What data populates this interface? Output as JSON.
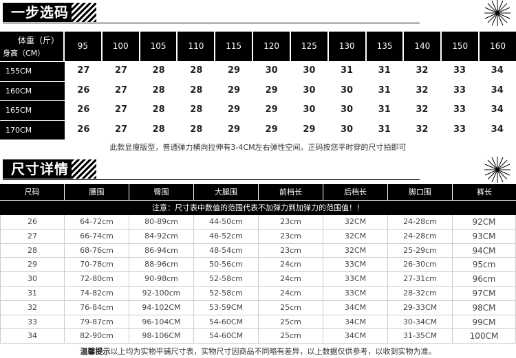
{
  "section1": {
    "title": "一步选码"
  },
  "table1": {
    "corner_top": "体重（斤）",
    "corner_bottom": "身高（CM）",
    "weights": [
      "95",
      "100",
      "105",
      "110",
      "115",
      "120",
      "125",
      "130",
      "135",
      "140",
      "150",
      "160"
    ],
    "rows": [
      {
        "height": "155CM",
        "sizes": [
          "27",
          "27",
          "28",
          "28",
          "29",
          "30",
          "30",
          "31",
          "31",
          "32",
          "33",
          "34"
        ]
      },
      {
        "height": "160CM",
        "sizes": [
          "26",
          "27",
          "28",
          "28",
          "29",
          "29",
          "30",
          "30",
          "31",
          "32",
          "33",
          "34"
        ]
      },
      {
        "height": "165CM",
        "sizes": [
          "26",
          "27",
          "28",
          "28",
          "29",
          "29",
          "30",
          "30",
          "31",
          "32",
          "33",
          "34"
        ]
      },
      {
        "height": "170CM",
        "sizes": [
          "26",
          "27",
          "28",
          "28",
          "29",
          "29",
          "29",
          "30",
          "31",
          "32",
          "33",
          "34"
        ]
      }
    ],
    "note": "此款显瘦版型，普通弹力横向拉伸有3-4CM左右弹性空间。正码按您平时穿的尺寸拍即可"
  },
  "section2": {
    "title": "尺寸详情"
  },
  "table2": {
    "headers": [
      "尺码",
      "腰围",
      "臀围",
      "大腿围",
      "前档长",
      "后档长",
      "脚口围",
      "裤长"
    ],
    "notice": "注意：尺寸表中数值的范围代表不加弹力到加弹力的范围值！！",
    "rows": [
      [
        "26",
        "64-72cm",
        "80-89cm",
        "44-50cm",
        "23cm",
        "32CM",
        "24-28cm",
        "92CM"
      ],
      [
        "27",
        "66-74cm",
        "84-92cm",
        "46-52cm",
        "23cm",
        "32CM",
        "24-28cm",
        "93CM"
      ],
      [
        "28",
        "68-76cm",
        "86-94cm",
        "48-54cm",
        "23cm",
        "32CM",
        "25-29cm",
        "94CM"
      ],
      [
        "29",
        "70-78cm",
        "88-96cm",
        "50-56cm",
        "24cm",
        "33CM",
        "26-30cm",
        "95cm"
      ],
      [
        "30",
        "72-80cm",
        "90-98cm",
        "52-58cm",
        "24cm",
        "33CM",
        "27-31cm",
        "96cm"
      ],
      [
        "31",
        "74-82cm",
        "92-100cm",
        "52-58cm",
        "24cm",
        "33CM",
        "28-32cm",
        "97CM"
      ],
      [
        "32",
        "76-84cm",
        "94-102CM",
        "53-59CM",
        "25cm",
        "34CM",
        "29-33CM",
        "98CM"
      ],
      [
        "33",
        "79-87cm",
        "96-104CM",
        "54-60CM",
        "25cm",
        "34CM",
        "30-34CM",
        "99CM"
      ],
      [
        "34",
        "82-90cm",
        "98-106CM",
        "54-60CM",
        "25cm",
        "34CM",
        "31-35CM",
        "100CM"
      ]
    ]
  },
  "footer": {
    "bold": "温馨提示",
    "text": "以上均为实物平铺尺寸表，实物尺寸因商品不同略有差异，以上数据仅供参考，以收到实物为准。"
  }
}
